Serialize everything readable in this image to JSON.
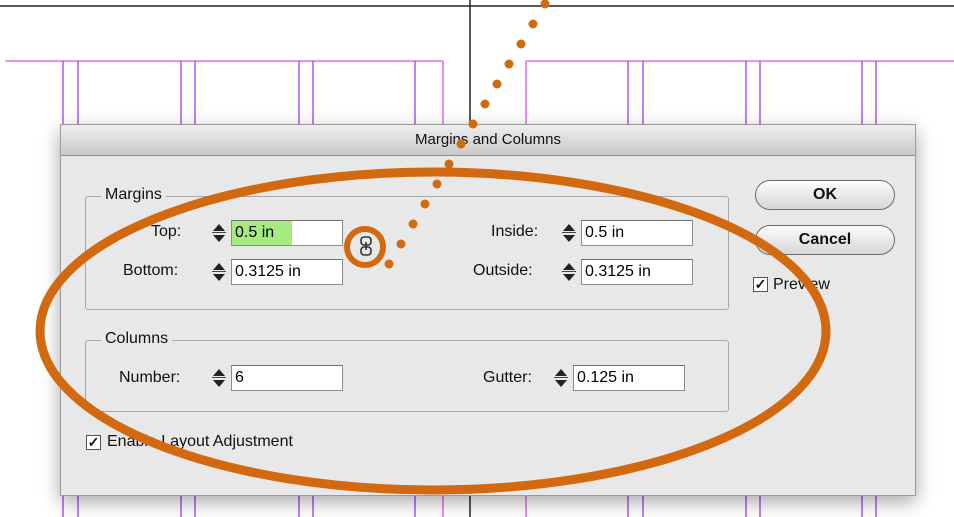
{
  "dialog": {
    "title": "Margins and Columns",
    "margins": {
      "legend": "Margins",
      "top_label": "Top:",
      "top_value": "0.5 in",
      "bottom_label": "Bottom:",
      "bottom_value": "0.3125 in",
      "inside_label": "Inside:",
      "inside_value": "0.5 in",
      "outside_label": "Outside:",
      "outside_value": "0.3125 in"
    },
    "columns": {
      "legend": "Columns",
      "number_label": "Number:",
      "number_value": "6",
      "gutter_label": "Gutter:",
      "gutter_value": "0.125 in"
    },
    "ok_label": "OK",
    "cancel_label": "Cancel",
    "preview_label": "Preview",
    "preview_checked": true,
    "enable_layout_label": "Enable Layout Adjustment",
    "enable_layout_checked": true
  },
  "icons": {
    "link": "chain-link-icon",
    "stepper": "up-down-arrows-icon",
    "checkbox": "checkmark-icon"
  },
  "colors": {
    "guide_purple": "#a23cf0",
    "guide_magenta": "#e04ff0",
    "annotation_orange": "#d2690f",
    "field_highlight": "#a7ea7f"
  }
}
